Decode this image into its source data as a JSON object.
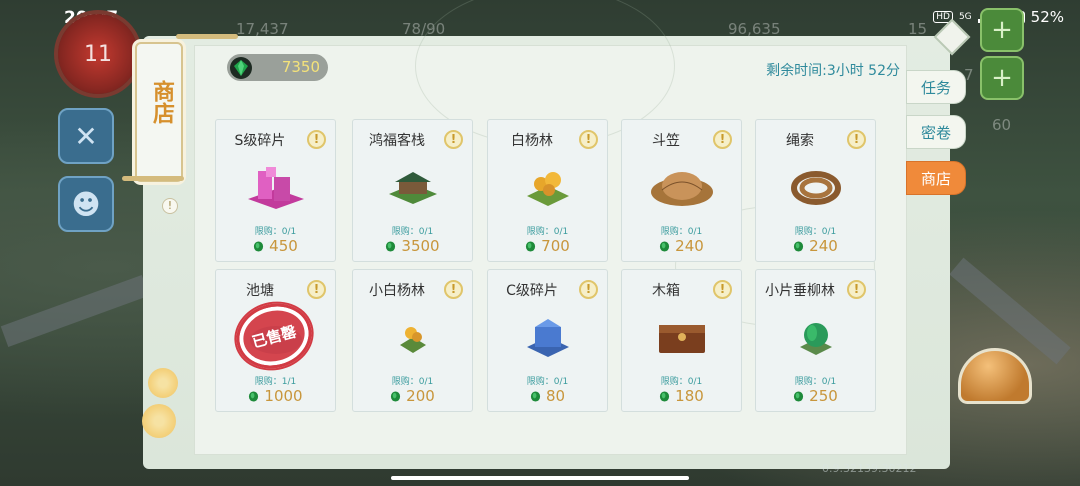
{
  "status_bar": {
    "time": "20:07",
    "hd": "HD",
    "network": "5G",
    "battery": "52%"
  },
  "hud": {
    "level": "11",
    "population": "17,437",
    "capacity": "78/90",
    "coins": "96,635",
    "gold": "15",
    "side_a": "7",
    "side_b": "60"
  },
  "shop": {
    "title": "商店",
    "currency_value": "7350",
    "timer": "剩余时间:3小时 52分",
    "tabs": [
      {
        "label": "任务",
        "active": false
      },
      {
        "label": "密卷",
        "active": false
      },
      {
        "label": "商店",
        "active": true
      }
    ],
    "sold_label": "已售罄",
    "items": [
      {
        "name": "S级碎片",
        "limit": "限购：0/1",
        "price": "450",
        "icon": "pink-building-icon",
        "sold": false
      },
      {
        "name": "鸿福客栈",
        "limit": "限购：0/1",
        "price": "3500",
        "icon": "inn-icon",
        "sold": false
      },
      {
        "name": "白杨林",
        "limit": "限购：0/1",
        "price": "700",
        "icon": "poplar-grove-icon",
        "sold": false
      },
      {
        "name": "斗笠",
        "limit": "限购：0/1",
        "price": "240",
        "icon": "bamboo-hat-icon",
        "sold": false
      },
      {
        "name": "绳索",
        "limit": "限购：0/1",
        "price": "240",
        "icon": "rope-icon",
        "sold": false
      },
      {
        "name": "池塘",
        "limit": "限购：1/1",
        "price": "1000",
        "icon": "pond-icon",
        "sold": true
      },
      {
        "name": "小白杨林",
        "limit": "限购：0/1",
        "price": "200",
        "icon": "small-poplar-icon",
        "sold": false
      },
      {
        "name": "C级碎片",
        "limit": "限购：0/1",
        "price": "80",
        "icon": "blue-building-icon",
        "sold": false
      },
      {
        "name": "木箱",
        "limit": "限购：0/1",
        "price": "180",
        "icon": "wooden-chest-icon",
        "sold": false
      },
      {
        "name": "小片垂柳林",
        "limit": "限购：0/1",
        "price": "250",
        "icon": "willow-grove-icon",
        "sold": false
      }
    ]
  },
  "version": "0.9.32139.30212",
  "colors": {
    "accent_teal": "#2f8a9c",
    "price_gold": "#c8963c",
    "active_tab": "#f08a3a",
    "gem_green": "#1e8a3a"
  }
}
